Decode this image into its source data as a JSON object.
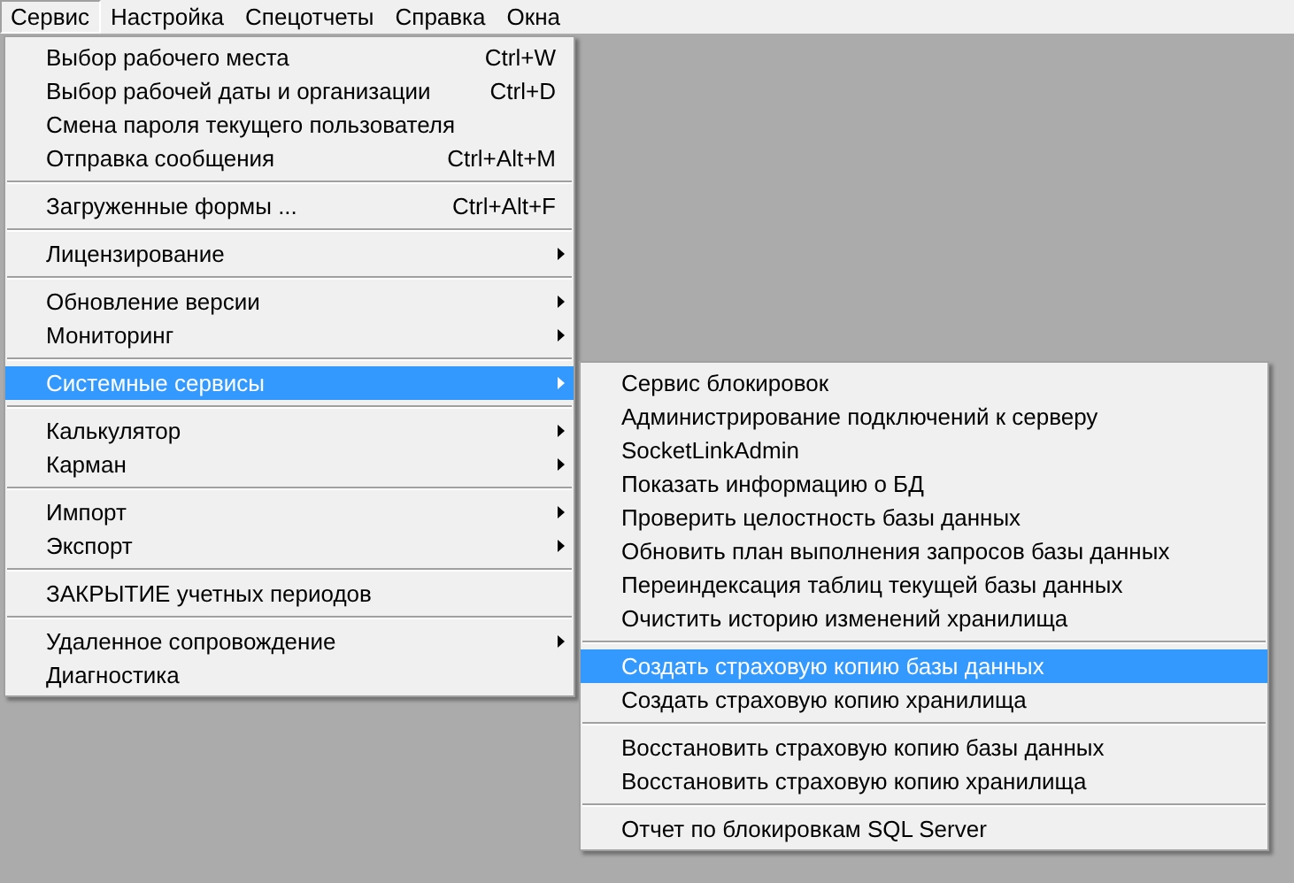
{
  "menubar": [
    {
      "label": "Сервис",
      "selected": true
    },
    {
      "label": "Настройка",
      "selected": false
    },
    {
      "label": "Спецотчеты",
      "selected": false
    },
    {
      "label": "Справка",
      "selected": false
    },
    {
      "label": "Окна",
      "selected": false
    }
  ],
  "menu": [
    {
      "kind": "item",
      "label": "Выбор рабочего места",
      "shortcut": "Ctrl+W",
      "submenu": false,
      "selected": false
    },
    {
      "kind": "item",
      "label": "Выбор рабочей даты и организации",
      "shortcut": "Ctrl+D",
      "submenu": false,
      "selected": false
    },
    {
      "kind": "item",
      "label": "Смена пароля текущего пользователя",
      "submenu": false,
      "selected": false
    },
    {
      "kind": "item",
      "label": "Отправка сообщения",
      "shortcut": "Ctrl+Alt+M",
      "submenu": false,
      "selected": false
    },
    {
      "kind": "separator"
    },
    {
      "kind": "item",
      "label": "Загруженные формы ...",
      "shortcut": "Ctrl+Alt+F",
      "submenu": false,
      "selected": false
    },
    {
      "kind": "separator"
    },
    {
      "kind": "item",
      "label": "Лицензирование",
      "submenu": true,
      "selected": false
    },
    {
      "kind": "separator"
    },
    {
      "kind": "item",
      "label": "Обновление версии",
      "submenu": true,
      "selected": false
    },
    {
      "kind": "item",
      "label": "Мониторинг",
      "submenu": true,
      "selected": false
    },
    {
      "kind": "separator"
    },
    {
      "kind": "item",
      "label": "Системные сервисы",
      "submenu": true,
      "selected": true
    },
    {
      "kind": "separator"
    },
    {
      "kind": "item",
      "label": "Калькулятор",
      "submenu": true,
      "selected": false
    },
    {
      "kind": "item",
      "label": "Карман",
      "submenu": true,
      "selected": false
    },
    {
      "kind": "separator"
    },
    {
      "kind": "item",
      "label": "Импорт",
      "submenu": true,
      "selected": false
    },
    {
      "kind": "item",
      "label": "Экспорт",
      "submenu": true,
      "selected": false
    },
    {
      "kind": "separator"
    },
    {
      "kind": "item",
      "label": "ЗАКРЫТИЕ учетных периодов",
      "submenu": false,
      "selected": false
    },
    {
      "kind": "separator"
    },
    {
      "kind": "item",
      "label": "Удаленное сопровождение",
      "submenu": true,
      "selected": false
    },
    {
      "kind": "item",
      "label": "Диагностика",
      "submenu": false,
      "selected": false
    }
  ],
  "submenu": [
    {
      "kind": "item",
      "label": "Сервис блокировок",
      "selected": false
    },
    {
      "kind": "item",
      "label": "Администрирование подключений к серверу",
      "selected": false
    },
    {
      "kind": "item",
      "label": "SocketLinkAdmin",
      "selected": false
    },
    {
      "kind": "item",
      "label": "Показать информацию о БД",
      "selected": false
    },
    {
      "kind": "item",
      "label": "Проверить целостность базы данных",
      "selected": false
    },
    {
      "kind": "item",
      "label": "Обновить план выполнения запросов базы данных",
      "selected": false
    },
    {
      "kind": "item",
      "label": "Переиндексация таблиц текущей базы данных",
      "selected": false
    },
    {
      "kind": "item",
      "label": "Очистить историю изменений хранилища",
      "selected": false
    },
    {
      "kind": "separator"
    },
    {
      "kind": "item",
      "label": "Создать страховую копию базы данных",
      "selected": true
    },
    {
      "kind": "item",
      "label": "Создать страховую копию хранилища",
      "selected": false
    },
    {
      "kind": "separator"
    },
    {
      "kind": "item",
      "label": "Восстановить страховую копию базы данных",
      "selected": false
    },
    {
      "kind": "item",
      "label": "Восстановить страховую копию хранилища",
      "selected": false
    },
    {
      "kind": "separator"
    },
    {
      "kind": "item",
      "label": "Отчет по блокировкам SQL Server",
      "selected": false
    }
  ]
}
